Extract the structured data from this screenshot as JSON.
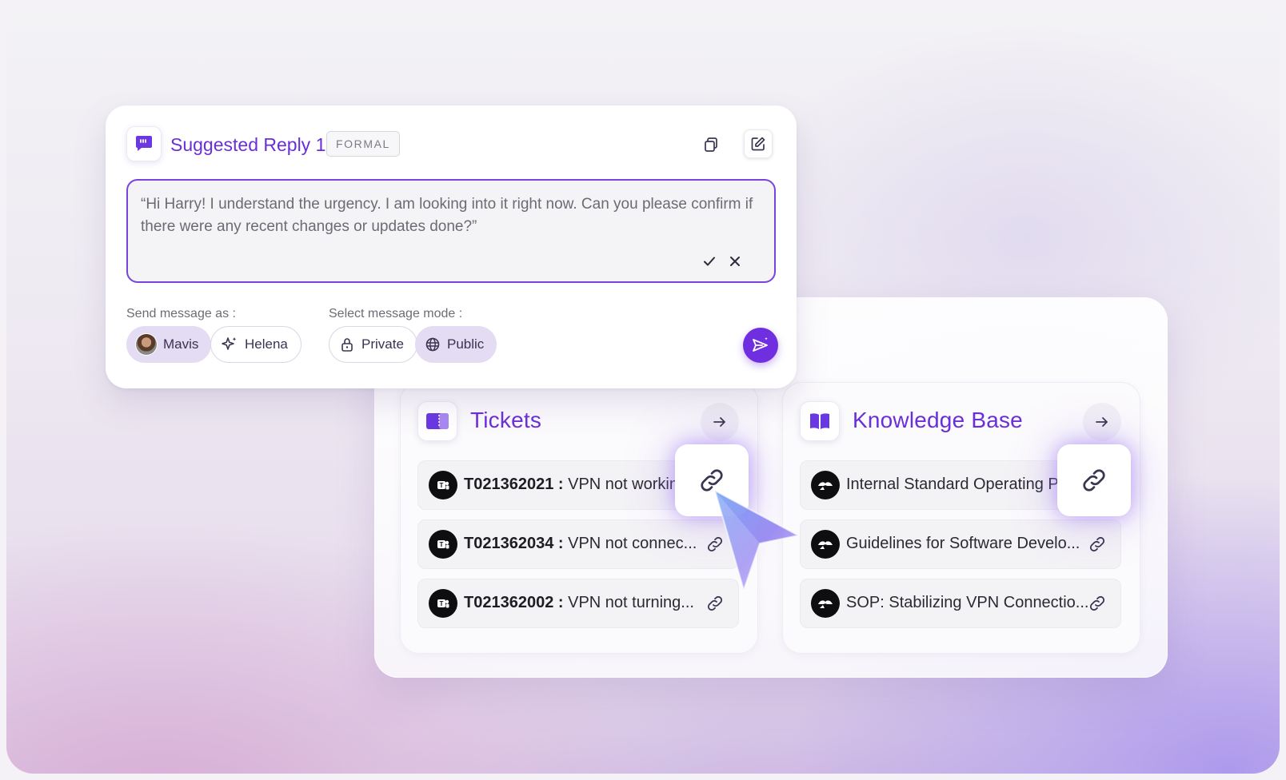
{
  "reply": {
    "title": "Suggested Reply 1",
    "badge": "FORMAL",
    "text": "“Hi Harry! I understand the urgency. I am looking into it right now. Can you please confirm if there were any recent changes or updates done?”",
    "send_as_label": "Send message as :",
    "senders": [
      {
        "name": "Mavis",
        "selected": true
      },
      {
        "name": "Helena",
        "selected": false
      }
    ],
    "mode_label": "Select message mode :",
    "modes": [
      {
        "name": "Private",
        "selected": false
      },
      {
        "name": "Public",
        "selected": true
      }
    ],
    "icons": [
      "quote-icon",
      "copy-icon",
      "edit-icon",
      "check-icon",
      "close-icon",
      "lock-icon",
      "globe-icon",
      "sparkle-icon",
      "send-icon"
    ]
  },
  "tickets": {
    "title": "Tickets",
    "items": [
      {
        "id": "T021362021 :",
        "text": " VPN not workin..."
      },
      {
        "id": "T021362034 :",
        "text": " VPN not connec..."
      },
      {
        "id": "T021362002 :",
        "text": " VPN not turning..."
      }
    ]
  },
  "knowledge_base": {
    "title": "Knowledge Base",
    "items": [
      {
        "text": "Internal Standard Operating Pr..."
      },
      {
        "text": "Guidelines for Software Develo..."
      },
      {
        "text": "SOP: Stabilizing VPN Connectio..."
      }
    ]
  },
  "colors": {
    "accent": "#6a2fd8",
    "send_button": "#6f2fe0",
    "selected_chip": "#e3dcf3"
  }
}
